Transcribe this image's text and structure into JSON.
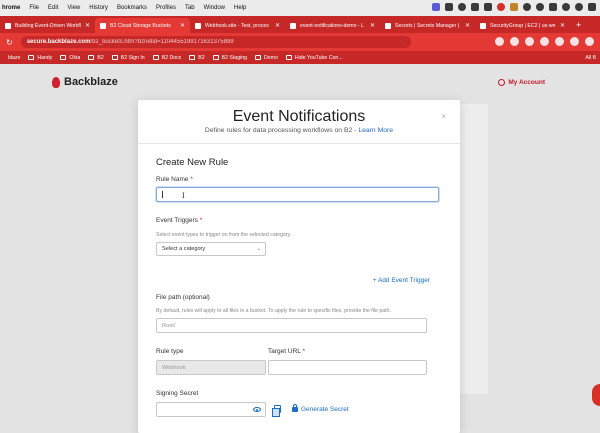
{
  "menubar": {
    "items": [
      "hrome",
      "File",
      "Edit",
      "View",
      "History",
      "Bookmarks",
      "Profiles",
      "Tab",
      "Window",
      "Help"
    ]
  },
  "tabs": [
    {
      "title": "Building Event-Driven Workfl",
      "active": false
    },
    {
      "title": "B2 Cloud Storage Buckets",
      "active": true
    },
    {
      "title": "Webhook.site - Test, proces",
      "active": false
    },
    {
      "title": "event-notifications-demo - L",
      "active": false
    },
    {
      "title": "Secrets | Secrets Manager |  ",
      "active": false
    },
    {
      "title": "SecurityGroup | EC2 | us-we",
      "active": false
    }
  ],
  "address": {
    "host": "secure.backblaze.com",
    "path": "/b2_buckets.htm?bznetid=1104455199171631375899"
  },
  "bookmarks": {
    "items": [
      "blaze",
      "Handy",
      "Okta",
      "B2",
      "B2 Sign In",
      "B2 Docs",
      "B2",
      "B2 Staging",
      "Demo",
      "Hide YouTube Con..."
    ],
    "all_label": "All B"
  },
  "site": {
    "logo_text": "Backblaze",
    "account_label": "My Account"
  },
  "modal": {
    "title": "Event Notifications",
    "subtitle": "Define rules for data processing workflows on B2 -",
    "learn_more": "Learn More",
    "close_label": "×",
    "section_title": "Create New Rule",
    "rule_name": {
      "label": "Rule Name",
      "required_mark": "*",
      "value": ""
    },
    "event_triggers": {
      "label": "Event Triggers",
      "required_mark": "*",
      "help": "Select event types to trigger on from the selected category.",
      "select_value": "Select a category",
      "add_label": "+ Add Event Trigger"
    },
    "file_path": {
      "label": "File path (optional)",
      "help": "By default, rules will apply to all files in a bucket. To apply the rule to specific files, provide the file path.",
      "placeholder": "Root/"
    },
    "rule_type": {
      "label": "Rule type",
      "value": "Webhook"
    },
    "target_url": {
      "label": "Target URL",
      "required_mark": "*",
      "value": ""
    },
    "signing_secret": {
      "label": "Signing Secret",
      "value": "",
      "generate_label": "Generate Secret"
    }
  },
  "colors": {
    "browser_red": "#e53935",
    "brand_red": "#c01826",
    "link_blue": "#1b6ec2"
  }
}
